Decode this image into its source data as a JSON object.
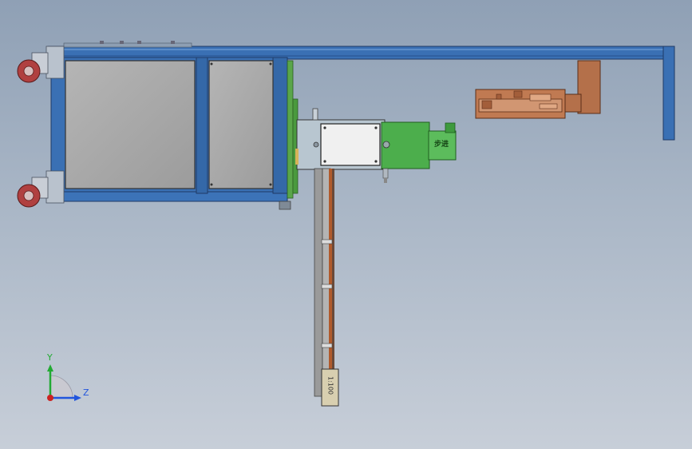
{
  "scene": {
    "colors": {
      "frame_blue": "#3a70b4",
      "frame_blue_dark": "#1f4d8a",
      "panel_grey": "#a9a9a9",
      "panel_light": "#c4c4c4",
      "green": "#4cae4c",
      "green_light": "#7cc96c",
      "copper": "#b4704a",
      "copper_light": "#d19672",
      "rail_grey": "#9e9e9e",
      "caster_red": "#b04040"
    },
    "stepper_label": "步进",
    "slide_label": "1:100",
    "triad": {
      "y_label": "Y",
      "z_label": "Z",
      "y_color": "#22aa33",
      "z_color": "#2255dd",
      "origin_color": "#cc2222"
    }
  }
}
